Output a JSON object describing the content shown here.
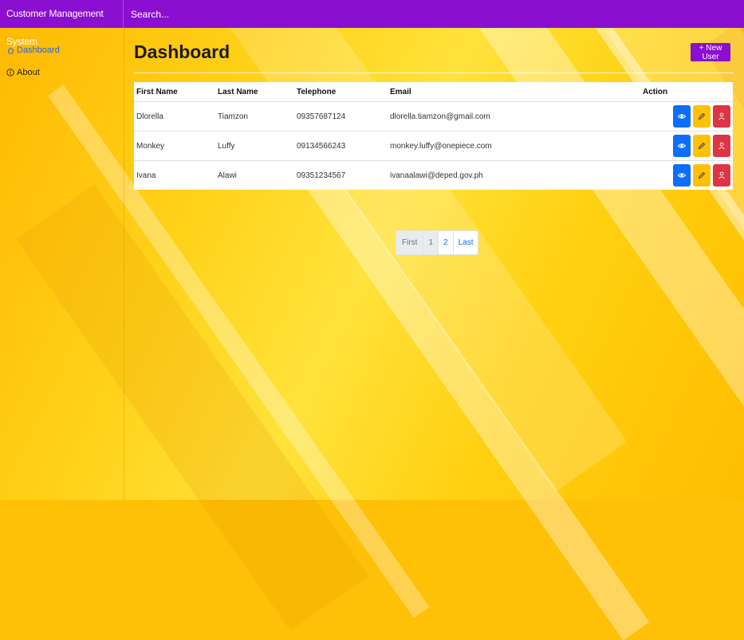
{
  "app": {
    "brand": "Customer Management System",
    "search_placeholder": "Search..."
  },
  "sidebar": {
    "items": [
      {
        "label": "Dashboard",
        "icon": "home-icon",
        "active": true
      },
      {
        "label": "About",
        "icon": "info-icon",
        "active": false
      }
    ]
  },
  "main": {
    "title": "Dashboard",
    "new_user_label": "+ New User"
  },
  "table": {
    "headers": {
      "first_name": "First Name",
      "last_name": "Last Name",
      "telephone": "Telephone",
      "email": "Email",
      "action": "Action"
    },
    "rows": [
      {
        "first_name": "Dlorella",
        "last_name": "Tiamzon",
        "telephone": "09357687124",
        "email": "dlorella.tiamzon@gmail.com"
      },
      {
        "first_name": "Monkey",
        "last_name": "Luffy",
        "telephone": "09134566243",
        "email": "monkey.luffy@onepiece.com"
      },
      {
        "first_name": "Ivana",
        "last_name": "Alawi",
        "telephone": "09351234567",
        "email": "ivanaalawi@deped.gov.ph"
      }
    ],
    "action_icons": [
      "eye-icon",
      "pencil-icon",
      "user-delete-icon"
    ]
  },
  "pagination": {
    "first": "First",
    "pages": [
      "1",
      "2"
    ],
    "last": "Last",
    "current": "1"
  },
  "colors": {
    "topbar": "#8a0fd1",
    "view_button": "#0d6efd",
    "edit_button": "#ffc107",
    "delete_button": "#dc3545",
    "active_link": "#2563eb"
  }
}
